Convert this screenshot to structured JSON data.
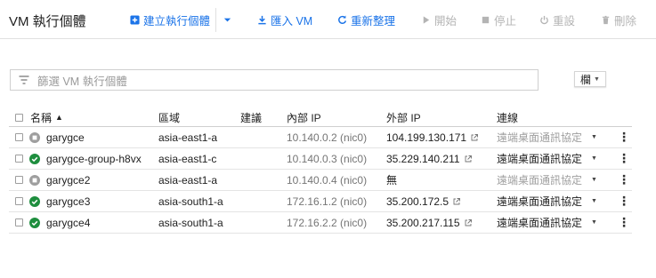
{
  "toolbar": {
    "title": "VM 執行個體",
    "create_label": "建立執行個體",
    "import_label": "匯入 VM",
    "refresh_label": "重新整理",
    "start_label": "開始",
    "stop_label": "停止",
    "reset_label": "重設",
    "delete_label": "刪除"
  },
  "filter": {
    "placeholder": "篩選 VM 執行個體"
  },
  "columns_button": {
    "label": "欄"
  },
  "table": {
    "headers": {
      "name": "名稱",
      "zone": "區域",
      "recommendation": "建議",
      "internal_ip": "內部 IP",
      "external_ip": "外部 IP",
      "connect": "連線"
    },
    "rows": [
      {
        "status": "stopped",
        "name": "garygce",
        "zone": "asia-east1-a",
        "internal_ip": "10.140.0.2 (nic0)",
        "external_ip": "104.199.130.171",
        "has_link": true,
        "connect": "遠端桌面通訊協定",
        "connect_enabled": false
      },
      {
        "status": "running",
        "name": "garygce-group-h8vx",
        "zone": "asia-east1-c",
        "internal_ip": "10.140.0.3 (nic0)",
        "external_ip": "35.229.140.211",
        "has_link": true,
        "connect": "遠端桌面通訊協定",
        "connect_enabled": true
      },
      {
        "status": "stopped",
        "name": "garygce2",
        "zone": "asia-east1-a",
        "internal_ip": "10.140.0.4 (nic0)",
        "external_ip": "無",
        "has_link": false,
        "connect": "遠端桌面通訊協定",
        "connect_enabled": false
      },
      {
        "status": "running",
        "name": "garygce3",
        "zone": "asia-south1-a",
        "internal_ip": "172.16.1.2 (nic0)",
        "external_ip": "35.200.172.5",
        "has_link": true,
        "connect": "遠端桌面通訊協定",
        "connect_enabled": true
      },
      {
        "status": "running",
        "name": "garygce4",
        "zone": "asia-south1-a",
        "internal_ip": "172.16.2.2 (nic0)",
        "external_ip": "35.200.217.115",
        "has_link": true,
        "connect": "遠端桌面通訊協定",
        "connect_enabled": true
      }
    ]
  },
  "colors": {
    "accent": "#1a73e8",
    "running": "#1e8e3e",
    "stopped": "#9e9e9e",
    "disabled": "#b4b4b4"
  }
}
